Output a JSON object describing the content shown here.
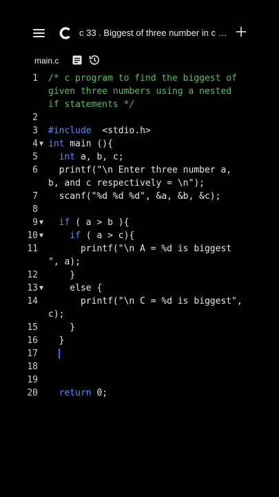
{
  "header": {
    "title": "c 33 . Biggest of three number in c pro...",
    "menu_icon": "hamburger-menu-icon",
    "logo_icon": "app-logo-icon",
    "add_icon": "plus-icon"
  },
  "filebar": {
    "filename": "main.c",
    "doc_icon": "document-icon",
    "history_icon": "history-icon"
  },
  "editor": {
    "lines": [
      {
        "n": "1",
        "fold": "",
        "seg": [
          [
            "c-comment",
            "/* c program to find the biggest of"
          ]
        ]
      },
      {
        "n": "",
        "fold": "",
        "seg": [
          [
            "c-comment",
            "given three numbers using a nested"
          ]
        ]
      },
      {
        "n": "",
        "fold": "",
        "seg": [
          [
            "c-comment",
            "if statements */"
          ]
        ]
      },
      {
        "n": "2",
        "fold": "",
        "seg": []
      },
      {
        "n": "3",
        "fold": "",
        "seg": [
          [
            "c-pre",
            "#include"
          ],
          [
            "",
            "  <stdio.h>"
          ]
        ]
      },
      {
        "n": "4",
        "fold": "▼",
        "seg": [
          [
            "c-type",
            "int"
          ],
          [
            "",
            " main (){"
          ]
        ]
      },
      {
        "n": "5",
        "fold": "",
        "seg": [
          [
            "",
            "  "
          ],
          [
            "c-type",
            "int"
          ],
          [
            "",
            " a, b, c;"
          ]
        ]
      },
      {
        "n": "6",
        "fold": "",
        "seg": [
          [
            "",
            "  printf(\"\\n Enter three number a,"
          ]
        ]
      },
      {
        "n": "",
        "fold": "",
        "seg": [
          [
            "",
            "b, and c respectively = \\n\");"
          ]
        ]
      },
      {
        "n": "7",
        "fold": "",
        "seg": [
          [
            "",
            "  scanf(\"%d %d %d\", &a, &b, &c);"
          ]
        ]
      },
      {
        "n": "8",
        "fold": "",
        "seg": []
      },
      {
        "n": "9",
        "fold": "▼",
        "seg": [
          [
            "",
            "  "
          ],
          [
            "c-kw",
            "if"
          ],
          [
            "",
            " ( a > b ){"
          ]
        ]
      },
      {
        "n": "10",
        "fold": "▼",
        "seg": [
          [
            "",
            "    "
          ],
          [
            "c-kw",
            "if"
          ],
          [
            "",
            " ( a > c){"
          ]
        ]
      },
      {
        "n": "11",
        "fold": "",
        "seg": [
          [
            "",
            "      printf(\"\\n A = %d is biggest"
          ]
        ]
      },
      {
        "n": "",
        "fold": "",
        "seg": [
          [
            "",
            "\", a);"
          ]
        ]
      },
      {
        "n": "12",
        "fold": "",
        "seg": [
          [
            "",
            "    }"
          ]
        ]
      },
      {
        "n": "13",
        "fold": "▼",
        "seg": [
          [
            "",
            "    else {"
          ]
        ]
      },
      {
        "n": "14",
        "fold": "",
        "seg": [
          [
            "",
            "      printf(\"\\n C = %d is biggest\","
          ]
        ]
      },
      {
        "n": "",
        "fold": "",
        "seg": [
          [
            "",
            "c);"
          ]
        ]
      },
      {
        "n": "15",
        "fold": "",
        "seg": [
          [
            "",
            "    }"
          ]
        ]
      },
      {
        "n": "16",
        "fold": "",
        "seg": [
          [
            "",
            "  }"
          ]
        ]
      },
      {
        "n": "17",
        "fold": "",
        "seg": [],
        "caret": true
      },
      {
        "n": "18",
        "fold": "",
        "seg": []
      },
      {
        "n": "19",
        "fold": "",
        "seg": []
      },
      {
        "n": "20",
        "fold": "",
        "seg": [
          [
            "",
            "  "
          ],
          [
            "c-kw",
            "return"
          ],
          [
            "",
            " 0;"
          ]
        ]
      }
    ]
  },
  "colors": {
    "background": "#000000",
    "comment": "#5fbf5f",
    "keyword": "#5b8cff",
    "caret": "#2f6bff"
  }
}
